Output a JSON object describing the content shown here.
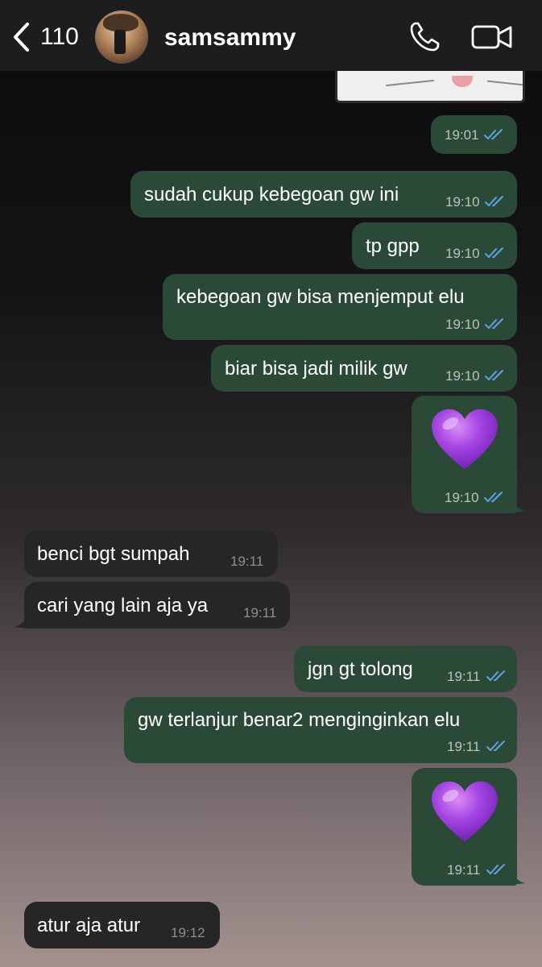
{
  "header": {
    "back_count": "110",
    "contact_name": "samsammy",
    "icons": {
      "back": "chevron-left-icon",
      "call": "phone-icon",
      "video": "video-camera-icon"
    }
  },
  "colors": {
    "outgoing_bubble": "#2a4a37",
    "incoming_bubble": "#262626",
    "read_ticks": "#5ea3e6",
    "heart": "#9b3ddb"
  },
  "messages": [
    {
      "dir": "out",
      "type": "image",
      "time": "19:01"
    },
    {
      "dir": "out",
      "text": "sudah cukup kebegoan gw ini",
      "time": "19:10"
    },
    {
      "dir": "out",
      "text": "tp gpp",
      "time": "19:10"
    },
    {
      "dir": "out",
      "text": "kebegoan gw bisa menjemput elu",
      "time": "19:10"
    },
    {
      "dir": "out",
      "text": "biar bisa jadi milik gw",
      "time": "19:10"
    },
    {
      "dir": "out",
      "type": "emoji",
      "emoji": "purple-heart-icon",
      "time": "19:10"
    },
    {
      "dir": "in",
      "text": "benci bgt sumpah",
      "time": "19:11"
    },
    {
      "dir": "in",
      "text": "cari yang lain aja ya",
      "time": "19:11"
    },
    {
      "dir": "out",
      "text": "jgn gt tolong",
      "time": "19:11"
    },
    {
      "dir": "out",
      "text": "gw terlanjur benar2 menginginkan elu",
      "time": "19:11"
    },
    {
      "dir": "out",
      "type": "emoji",
      "emoji": "purple-heart-icon",
      "time": "19:11"
    },
    {
      "dir": "in",
      "text": "atur aja atur",
      "time": "19:12"
    }
  ]
}
